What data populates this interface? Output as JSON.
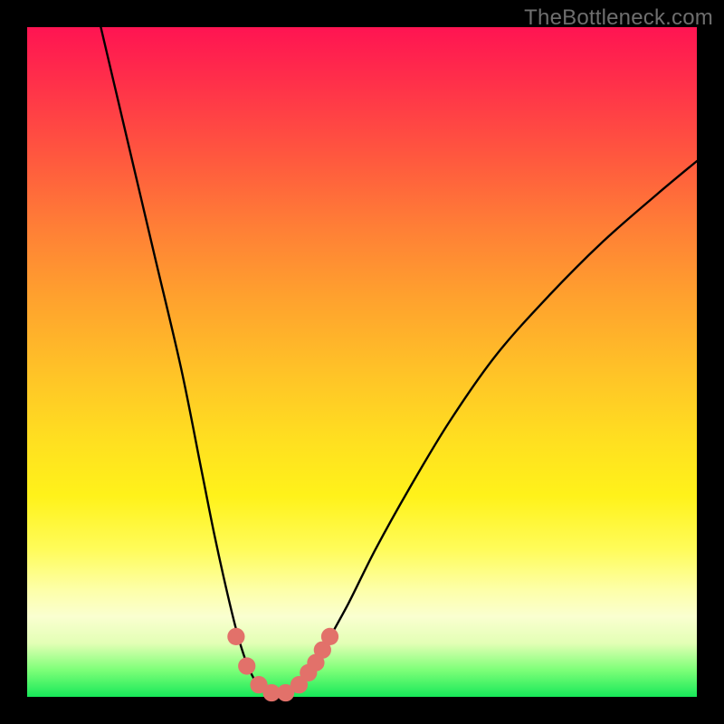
{
  "watermark": "TheBottleneck.com",
  "chart_data": {
    "type": "line",
    "title": "",
    "xlabel": "",
    "ylabel": "",
    "xlim": [
      0,
      100
    ],
    "ylim": [
      0,
      100
    ],
    "gradient_stops": [
      {
        "pos": 0,
        "color": "#ff1452"
      },
      {
        "pos": 8,
        "color": "#ff2f4a"
      },
      {
        "pos": 20,
        "color": "#ff5a3e"
      },
      {
        "pos": 30,
        "color": "#ff7f36"
      },
      {
        "pos": 40,
        "color": "#ffa02e"
      },
      {
        "pos": 52,
        "color": "#ffc427"
      },
      {
        "pos": 62,
        "color": "#ffe020"
      },
      {
        "pos": 70,
        "color": "#fff21a"
      },
      {
        "pos": 78,
        "color": "#fffc5a"
      },
      {
        "pos": 84,
        "color": "#fdffa8"
      },
      {
        "pos": 88,
        "color": "#faffd0"
      },
      {
        "pos": 92,
        "color": "#e3ffb5"
      },
      {
        "pos": 96,
        "color": "#7dff78"
      },
      {
        "pos": 100,
        "color": "#17e859"
      }
    ],
    "series": [
      {
        "name": "bottleneck-curve",
        "stroke": "#000000",
        "points_xy": [
          [
            11,
            100
          ],
          [
            15,
            83
          ],
          [
            19,
            66
          ],
          [
            23,
            49
          ],
          [
            26,
            34
          ],
          [
            28,
            24
          ],
          [
            30,
            15
          ],
          [
            31.5,
            9
          ],
          [
            33,
            4.5
          ],
          [
            34.5,
            1.8
          ],
          [
            36.5,
            0.5
          ],
          [
            39,
            0.5
          ],
          [
            41,
            1.8
          ],
          [
            43,
            4.5
          ],
          [
            45,
            8.5
          ],
          [
            48,
            14
          ],
          [
            52,
            22
          ],
          [
            57,
            31
          ],
          [
            63,
            41
          ],
          [
            70,
            51
          ],
          [
            78,
            60
          ],
          [
            86,
            68
          ],
          [
            94,
            75
          ],
          [
            100,
            80
          ]
        ]
      }
    ],
    "markers": {
      "color": "#e2716a",
      "radius_pct": 1.3,
      "points_xy": [
        [
          31.2,
          9.0
        ],
        [
          32.8,
          4.6
        ],
        [
          34.6,
          1.8
        ],
        [
          36.5,
          0.6
        ],
        [
          38.6,
          0.6
        ],
        [
          40.6,
          1.8
        ],
        [
          42.0,
          3.6
        ],
        [
          43.1,
          5.1
        ],
        [
          44.1,
          7.0
        ],
        [
          45.2,
          9.0
        ]
      ]
    }
  }
}
